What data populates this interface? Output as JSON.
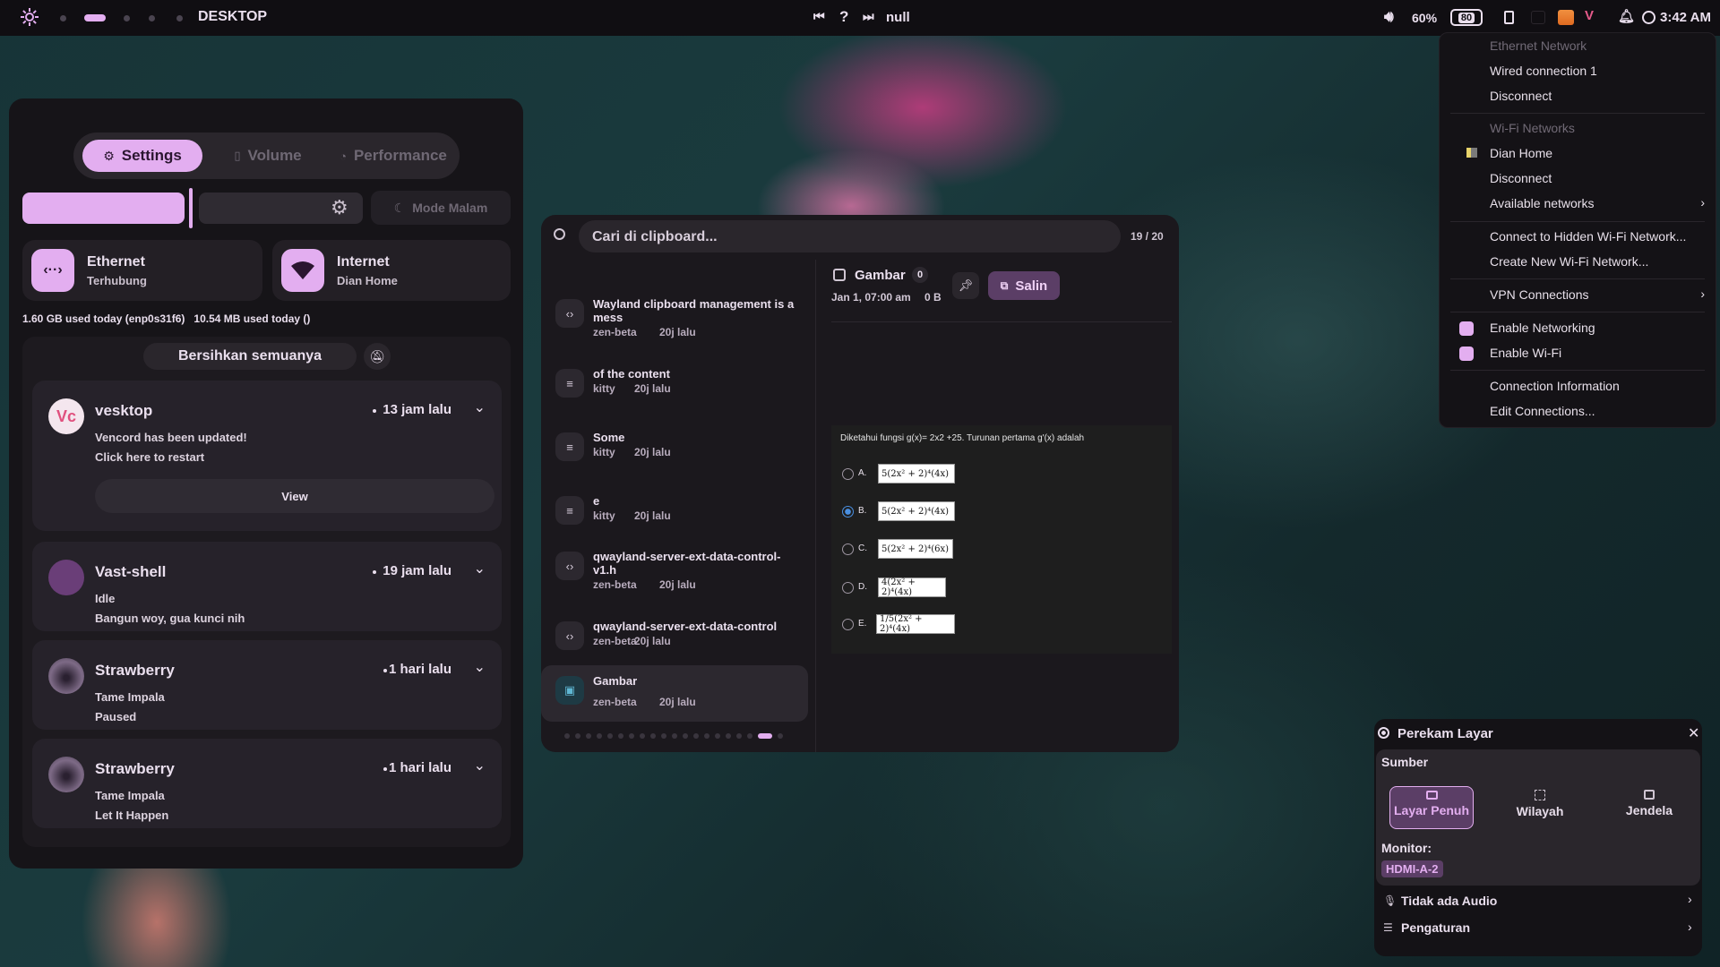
{
  "topbar": {
    "workspace_label": "DESKTOP",
    "media_title": "null",
    "volume": "60%",
    "battery": "80",
    "clock": "3:42 AM"
  },
  "quick_settings": {
    "tabs": [
      "Settings",
      "Volume",
      "Performance"
    ],
    "night_mode_label": "Mode Malam",
    "ethernet": {
      "title": "Ethernet",
      "status": "Terhubung"
    },
    "internet": {
      "title": "Internet",
      "status": "Dian Home"
    },
    "usage_text": "1.60 GB used today (enp0s31f6)   10.54 MB used today ()",
    "clear_all_label": "Bersihkan semuanya",
    "notifications": [
      {
        "app": "vesktop",
        "time": "13 jam lalu",
        "line1": "Vencord has been updated!",
        "line2": "Click here to restart",
        "action": "View"
      },
      {
        "app": "Vast-shell",
        "time": "19 jam lalu",
        "line1": "Idle",
        "line2": "Bangun woy, gua kunci nih"
      },
      {
        "app": "Strawberry",
        "time": "1 hari lalu",
        "line1": "Tame Impala",
        "line2": "Paused"
      },
      {
        "app": "Strawberry",
        "time": "1 hari lalu",
        "line1": "Tame Impala",
        "line2": "Let It Happen"
      }
    ]
  },
  "clipboard": {
    "search_placeholder": "Cari di clipboard...",
    "counter": "19 / 20",
    "items": [
      {
        "title": "Wayland clipboard management is a mess",
        "source": "zen-beta",
        "time": "20j lalu",
        "icon": "code-icon"
      },
      {
        "title": "of the content",
        "source": "kitty",
        "time": "20j lalu",
        "icon": "text-icon"
      },
      {
        "title": "Some",
        "source": "kitty",
        "time": "20j lalu",
        "icon": "text-icon"
      },
      {
        "title": "e",
        "source": "kitty",
        "time": "20j lalu",
        "icon": "text-icon"
      },
      {
        "title": "qwayland-server-ext-data-control-v1.h",
        "source": "zen-beta",
        "time": "20j lalu",
        "icon": "code-icon"
      },
      {
        "title": "qwayland-server-ext-data-control",
        "source": "zen-beta",
        "time": "20j lalu",
        "icon": "code-icon"
      },
      {
        "title": "Gambar",
        "source": "zen-beta",
        "time": "20j lalu",
        "icon": "image-icon"
      }
    ],
    "detail": {
      "title": "Gambar",
      "badge": "0",
      "date": "Jan 1, 07:00 am",
      "size": "0 B",
      "copy_label": "Salin"
    },
    "preview": {
      "question": "Diketahui fungsi g(x)= 2x2 +25. Turunan pertama g'(x) adalah",
      "options": [
        {
          "letter": "A.",
          "expr": "5(2x² + 2)⁴(4x)",
          "selected": false
        },
        {
          "letter": "B.",
          "expr": "5(2x² + 2)⁴(4x)",
          "selected": true
        },
        {
          "letter": "C.",
          "expr": "5(2x² + 2)⁴(6x)",
          "selected": false
        },
        {
          "letter": "D.",
          "expr": "4(2x² + 2)⁴(4x)",
          "selected": false
        },
        {
          "letter": "E.",
          "expr": "1/5(2x² + 2)⁴(4x)",
          "selected": false
        }
      ]
    }
  },
  "network_menu": {
    "ethernet_header": "Ethernet Network",
    "wired": "Wired connection 1",
    "disconnect1": "Disconnect",
    "wifi_header": "Wi-Fi Networks",
    "wifi_name": "Dian Home",
    "disconnect2": "Disconnect",
    "available": "Available networks",
    "hidden": "Connect to Hidden Wi-Fi Network...",
    "create": "Create New Wi-Fi Network...",
    "vpn": "VPN Connections",
    "enable_networking": "Enable Networking",
    "enable_wifi": "Enable Wi-Fi",
    "conn_info": "Connection Information",
    "edit": "Edit Connections..."
  },
  "recorder": {
    "title": "Perekam Layar",
    "source_label": "Sumber",
    "modes": [
      "Layar Penuh",
      "Wilayah",
      "Jendela"
    ],
    "monitor_label": "Monitor:",
    "monitor_value": "HDMI-A-2",
    "audio": "Tidak ada Audio",
    "settings": "Pengaturan"
  }
}
